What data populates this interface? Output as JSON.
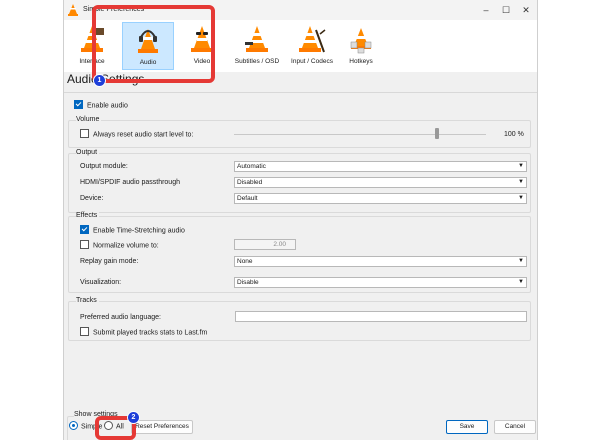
{
  "window": {
    "title": "Simple Preferences"
  },
  "toolbar": {
    "items": [
      {
        "label": "Interface",
        "icon": "vlc-cone-interface-icon"
      },
      {
        "label": "Audio",
        "icon": "vlc-cone-headphones-icon"
      },
      {
        "label": "Video",
        "icon": "vlc-cone-sunglasses-icon"
      },
      {
        "label": "Subtitles / OSD",
        "icon": "vlc-cone-subtitles-icon"
      },
      {
        "label": "Input / Codecs",
        "icon": "vlc-cone-input-icon"
      },
      {
        "label": "Hotkeys",
        "icon": "vlc-cone-hotkeys-icon"
      }
    ]
  },
  "heading": "Audio Settings",
  "enable_audio": {
    "label": "Enable audio",
    "checked": true
  },
  "volume": {
    "title": "Volume",
    "reset_label": "Always reset audio start level to:",
    "reset_checked": false,
    "level": "100 %"
  },
  "output": {
    "title": "Output",
    "module_label": "Output module:",
    "module_value": "Automatic",
    "passthrough_label": "HDMI/SPDIF audio passthrough",
    "passthrough_value": "Disabled",
    "device_label": "Device:",
    "device_value": "Default"
  },
  "effects": {
    "title": "Effects",
    "time_stretch_label": "Enable Time-Stretching audio",
    "time_stretch_checked": true,
    "normalize_label": "Normalize volume to:",
    "normalize_checked": false,
    "normalize_value": "2.00",
    "replay_label": "Replay gain mode:",
    "replay_value": "None",
    "vis_label": "Visualization:",
    "vis_value": "Disable"
  },
  "tracks": {
    "title": "Tracks",
    "lang_label": "Preferred audio language:",
    "lang_value": "",
    "lastfm_label": "Submit played tracks stats to Last.fm",
    "lastfm_checked": false
  },
  "footer": {
    "show_label": "Show settings",
    "simple_label": "Simple",
    "all_label": "All",
    "reset_button": "Reset Preferences",
    "save_button": "Save",
    "cancel_button": "Cancel"
  },
  "annotations": {
    "marker1": "1",
    "marker2": "2",
    "highlight_color": "#e53935",
    "marker_color": "#1e3fd9"
  },
  "colors": {
    "accent": "#0067c0",
    "selected_tab_bg": "#cce8ff"
  }
}
